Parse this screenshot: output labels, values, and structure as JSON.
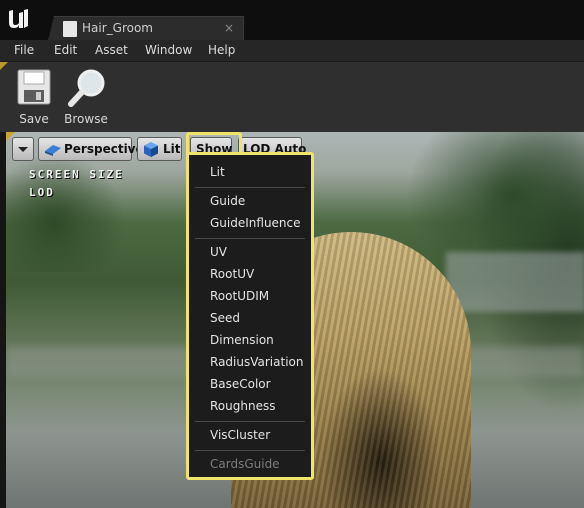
{
  "window": {
    "tab_title": "Hair_Groom",
    "tab_close": "×"
  },
  "menu": [
    "File",
    "Edit",
    "Asset",
    "Window",
    "Help"
  ],
  "toolbar": {
    "save_label": "Save",
    "browse_label": "Browse"
  },
  "viewport": {
    "perspective_label": "Perspective",
    "lit_label": "Lit",
    "show_label": "Show",
    "lod_label": "LOD Auto",
    "overlay_line1": "SCREEN SIZE",
    "overlay_line2": "LOD"
  },
  "show_menu": {
    "group1": [
      "Lit"
    ],
    "group2": [
      "Guide",
      "GuideInfluence"
    ],
    "group3": [
      "UV",
      "RootUV",
      "RootUDIM",
      "Seed",
      "Dimension",
      "RadiusVariation",
      "BaseColor",
      "Roughness"
    ],
    "group4": [
      "VisCluster"
    ],
    "group5": [
      "CardsGuide"
    ]
  },
  "colors": {
    "highlight": "#f0e36a",
    "accent": "#c9a532"
  }
}
